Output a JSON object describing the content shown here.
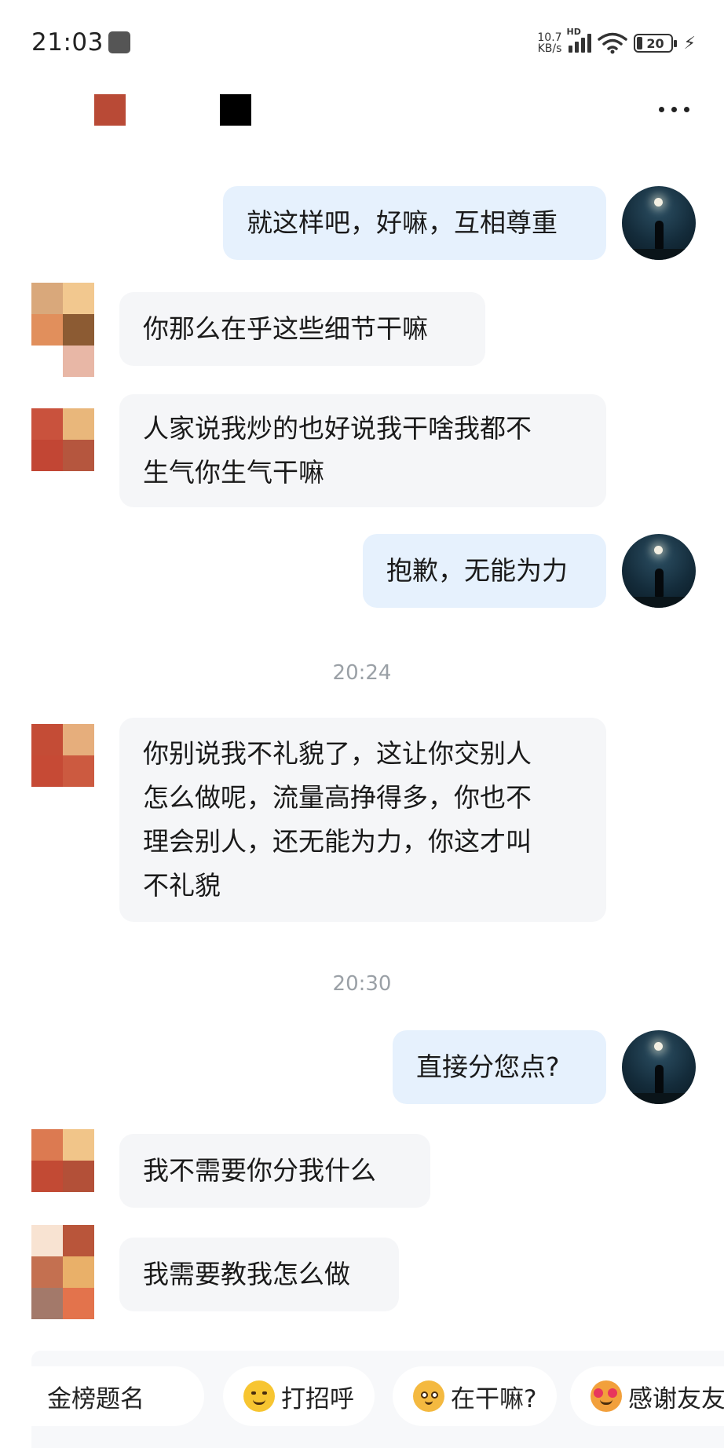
{
  "status_bar": {
    "time": "21:03",
    "net_speed_value": "10.7",
    "net_speed_unit": "KB/s",
    "network_label": "HD",
    "battery_level": "20",
    "wifi_icon": "wifi-icon",
    "charging_icon": "charging-bolt-icon"
  },
  "nav": {
    "more_icon": "more-dots-icon"
  },
  "messages": [
    {
      "side": "out",
      "lines": [
        "就这样吧，好嘛，互相尊重"
      ]
    },
    {
      "side": "in",
      "lines": [
        "你那么在乎这些细节干嘛"
      ]
    },
    {
      "side": "in",
      "lines": [
        "人家说我炒的也好说我干啥我都不",
        "生气你生气干嘛"
      ]
    },
    {
      "side": "out",
      "lines": [
        "抱歉，无能为力"
      ]
    },
    {
      "type": "timestamp",
      "text": "20:24"
    },
    {
      "side": "in",
      "lines": [
        "你别说我不礼貌了，这让你交别人",
        "怎么做呢，流量高挣得多，你也不",
        "理会别人，还无能为力，你这才叫",
        "不礼貌"
      ]
    },
    {
      "type": "timestamp",
      "text": "20:30"
    },
    {
      "side": "out",
      "lines": [
        "直接分您点?"
      ]
    },
    {
      "side": "in",
      "lines": [
        "我不需要你分我什么"
      ]
    },
    {
      "side": "in",
      "lines": [
        "我需要教我怎么做"
      ]
    }
  ],
  "quick_replies": [
    {
      "label": "金榜题名",
      "visible": "金榜题名"
    },
    {
      "label": "打招呼",
      "icon": "smile-face-icon"
    },
    {
      "label": "在干嘛?",
      "icon": "thinking-face-icon"
    },
    {
      "label": "感谢友友",
      "icon": "love-face-icon"
    }
  ],
  "colors": {
    "incoming_bubble": "#f5f6f8",
    "outgoing_bubble": "#e6f1fd",
    "timestamp": "#9aa0a6"
  }
}
